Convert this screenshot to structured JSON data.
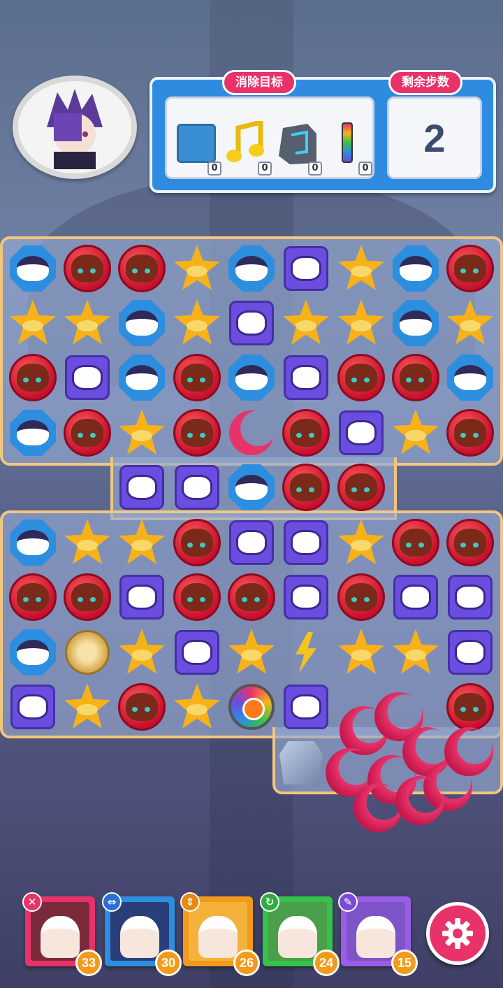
{
  "hud": {
    "goal_label": "消除目标",
    "moves_label": "剩余步数",
    "moves_left": "2",
    "goals": [
      {
        "icon": "blue-tile-icon",
        "count": "0"
      },
      {
        "icon": "music-note-icon",
        "count": "0"
      },
      {
        "icon": "stone-block-icon",
        "count": "0"
      },
      {
        "icon": "rainbow-bar-icon",
        "count": "0"
      }
    ]
  },
  "board": {
    "rows": [
      [
        "blue",
        "red",
        "red",
        "star",
        "blue",
        "purple",
        "star",
        "blue",
        "red"
      ],
      [
        "star",
        "star",
        "blue",
        "star",
        "purple",
        "star",
        "star",
        "blue",
        "star"
      ],
      [
        "red",
        "purple",
        "blue",
        "red",
        "blue",
        "purple",
        "red",
        "red",
        "blue"
      ],
      [
        "blue",
        "red",
        "star",
        "red",
        "moon",
        "red",
        "purple",
        "star",
        "red"
      ],
      [
        "",
        "",
        "purple",
        "purple",
        "blue",
        "red",
        "red",
        "",
        ""
      ],
      [
        "blue",
        "star",
        "star",
        "red",
        "purple",
        "purple",
        "star",
        "red",
        "red"
      ],
      [
        "red",
        "red",
        "purple",
        "red",
        "red",
        "purple",
        "red",
        "purple",
        "purple"
      ],
      [
        "blue",
        "gold",
        "star",
        "purple",
        "star",
        "bolt",
        "star",
        "star",
        "purple"
      ],
      [
        "purple",
        "star",
        "red",
        "star",
        "rainbow",
        "purple",
        "",
        "",
        "red"
      ]
    ]
  },
  "characters": [
    {
      "name": "character-1",
      "count": "33",
      "badge": "✕",
      "badge_color": "#e8336a",
      "frame": "#e8336a",
      "bg": "#7a2a3a"
    },
    {
      "name": "character-2",
      "count": "30",
      "badge": "⇔",
      "badge_color": "#2d6fd8",
      "frame": "#2d8ee0",
      "bg": "#2a3f7a"
    },
    {
      "name": "character-3",
      "count": "26",
      "badge": "⇕",
      "badge_color": "#e58a12",
      "frame": "#f29a1a",
      "bg": "#f4b23a"
    },
    {
      "name": "character-4",
      "count": "24",
      "badge": "↻",
      "badge_color": "#2fae3d",
      "frame": "#35c24a",
      "bg": "#4aa04a"
    },
    {
      "name": "character-5",
      "count": "15",
      "badge": "✎",
      "badge_color": "#7b4ad8",
      "frame": "#9b5de5",
      "bg": "#7d55c9"
    }
  ],
  "colors": {
    "accent": "#e8336a",
    "panel": "#2f8be0",
    "board_border": "#f3c67f"
  }
}
